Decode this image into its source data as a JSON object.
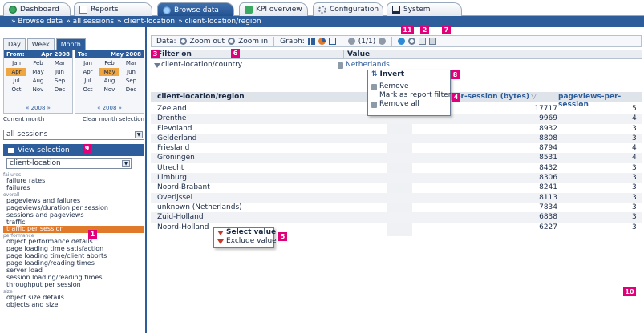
{
  "tabs": [
    {
      "label": "Dashboard",
      "icon": "globe-icon"
    },
    {
      "label": "Reports",
      "icon": "report-icon"
    },
    {
      "label": "Browse data",
      "icon": "globe-icon"
    },
    {
      "label": "KPI overview",
      "icon": "kpi-icon"
    },
    {
      "label": "Configuration",
      "icon": "gear-icon"
    },
    {
      "label": "System",
      "icon": "monitor-icon"
    }
  ],
  "breadcrumb": [
    "» Browse data",
    "» all sessions",
    "» client-location",
    "» client-location/region"
  ],
  "period_tabs": [
    "Day",
    "Week",
    "Month"
  ],
  "calendar": {
    "from_label": "From:",
    "from_value": "Apr 2008",
    "to_label": "To:",
    "to_value": "May 2008",
    "months": [
      "Jan",
      "Feb",
      "Mar",
      "Apr",
      "May",
      "Jun",
      "Jul",
      "Aug",
      "Sep",
      "Oct",
      "Nov",
      "Dec"
    ],
    "from_year": "« 2008 »",
    "to_year": "« 2008 »",
    "current_month": "Current month",
    "clear_month": "Clear month selection"
  },
  "session_select": "all sessions",
  "view_selection": "View selection",
  "location_select": "client-location",
  "nav": [
    {
      "group": "failures",
      "items": [
        "failure rates",
        "failures"
      ]
    },
    {
      "group": "overall",
      "items": [
        "pageviews and failures",
        "pageviews/duration per session",
        "sessions and pageviews",
        "traffic",
        "traffic per session"
      ]
    },
    {
      "group": "performance",
      "items": [
        "object performance details",
        "page loading time satisfaction",
        "page loading time/client aborts",
        "page loading/reading times",
        "server load",
        "session loading/reading times",
        "throughput per session"
      ]
    },
    {
      "group": "size",
      "items": [
        "object size details",
        "objects and size"
      ]
    }
  ],
  "active_nav": "traffic per session",
  "toolbar": {
    "data_label": "Data:",
    "zoom_out": "Zoom out",
    "zoom_in": "Zoom in",
    "graph_label": "Graph:",
    "page_info": "(1/1)"
  },
  "filter": {
    "head_filter": "Filter on",
    "head_value": "Value",
    "field": "client-location/country",
    "value": "Netherlands"
  },
  "table": {
    "col1": "client-location/region",
    "col2": "per-session (bytes)",
    "col3": "pageviews-per-session",
    "rows": [
      {
        "name": "Zeeland",
        "v1": "17717",
        "v2": "5"
      },
      {
        "name": "Drenthe",
        "v1": "9969",
        "v2": "4"
      },
      {
        "name": "Flevoland",
        "v1": "8932",
        "v2": "3"
      },
      {
        "name": "Gelderland",
        "v1": "8808",
        "v2": "3"
      },
      {
        "name": "Friesland",
        "v1": "8794",
        "v2": "4"
      },
      {
        "name": "Groningen",
        "v1": "8531",
        "v2": "4"
      },
      {
        "name": "Utrecht",
        "v1": "8432",
        "v2": "3"
      },
      {
        "name": "Limburg",
        "v1": "8306",
        "v2": "3"
      },
      {
        "name": "Noord-Brabant",
        "v1": "8241",
        "v2": "3"
      },
      {
        "name": "Overijssel",
        "v1": "8113",
        "v2": "3"
      },
      {
        "name": "unknown (Netherlands)",
        "v1": "7834",
        "v2": "3"
      },
      {
        "name": "Zuid-Holland",
        "v1": "6838",
        "v2": "3"
      },
      {
        "name": "Noord-Holland",
        "v1": "6227",
        "v2": "3"
      }
    ]
  },
  "context_menu": {
    "invert": "Invert",
    "remove": "Remove",
    "mark_report_filter": "Mark as report filter",
    "remove_all": "Remove all"
  },
  "value_menu": {
    "select_value": "Select value",
    "exclude_value": "Exclude value"
  },
  "markers": [
    "1",
    "2",
    "3",
    "4",
    "5",
    "6",
    "7",
    "8",
    "9",
    "10",
    "11"
  ],
  "colors": {
    "brand_blue": "#2d5d9b",
    "active_orange": "#e0792a",
    "marker_pink": "#e2007a"
  }
}
